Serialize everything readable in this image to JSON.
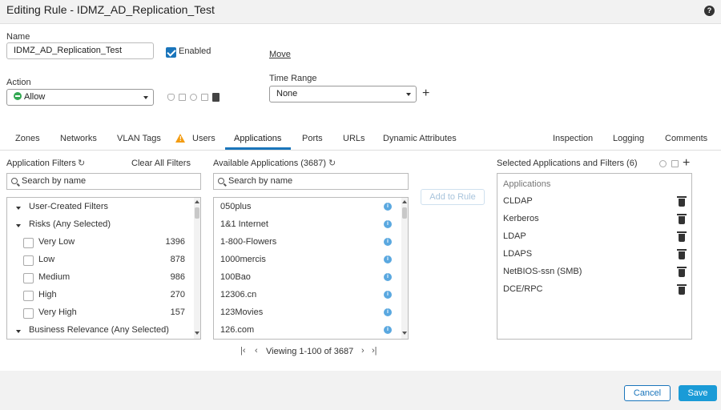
{
  "window": {
    "title": "Editing Rule - IDMZ_AD_Replication_Test",
    "help_icon": "help-icon"
  },
  "form": {
    "name_label": "Name",
    "name_value": "IDMZ_AD_Replication_Test",
    "enabled_label": "Enabled",
    "enabled_checked": true,
    "move_link": "Move",
    "action_label": "Action",
    "action_value": "Allow",
    "time_range_label": "Time Range",
    "time_range_value": "None"
  },
  "tabs": [
    {
      "label": "Zones"
    },
    {
      "label": "Networks"
    },
    {
      "label": "VLAN Tags"
    },
    {
      "label": "Users"
    },
    {
      "label": "Applications"
    },
    {
      "label": "Ports"
    },
    {
      "label": "URLs"
    },
    {
      "label": "Dynamic Attributes"
    },
    {
      "label": "Inspection"
    },
    {
      "label": "Logging"
    },
    {
      "label": "Comments"
    }
  ],
  "filters": {
    "title": "Application Filters",
    "clear_all": "Clear All Filters",
    "search_placeholder": "Search by name",
    "groups": [
      {
        "label": "User-Created Filters"
      },
      {
        "label": "Risks (Any Selected)"
      }
    ],
    "risk_items": [
      {
        "label": "Very Low",
        "count": "1396"
      },
      {
        "label": "Low",
        "count": "878"
      },
      {
        "label": "Medium",
        "count": "986"
      },
      {
        "label": "High",
        "count": "270"
      },
      {
        "label": "Very High",
        "count": "157"
      }
    ],
    "business_relevance": "Business Relevance (Any Selected)"
  },
  "available": {
    "title": "Available Applications (3687)",
    "search_placeholder": "Search by name",
    "items": [
      "050plus",
      "1&1 Internet",
      "1-800-Flowers",
      "1000mercis",
      "100Bao",
      "12306.cn",
      "123Movies",
      "126.com"
    ],
    "pagination": "Viewing 1-100 of 3687"
  },
  "add_to_rule": "Add to Rule",
  "selected": {
    "title": "Selected Applications and Filters (6)",
    "header": "Applications",
    "items": [
      "CLDAP",
      "Kerberos",
      "LDAP",
      "LDAPS",
      "NetBIOS-ssn (SMB)",
      "DCE/RPC"
    ]
  },
  "buttons": {
    "cancel": "Cancel",
    "save": "Save"
  },
  "colors": {
    "accent": "#1a75bb",
    "allow": "#34a853",
    "warning": "#f39c12",
    "info": "#5aa8e0"
  }
}
